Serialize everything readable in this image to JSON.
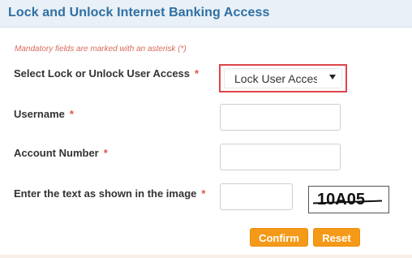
{
  "page": {
    "title": "Lock and Unlock Internet Banking Access",
    "mandatory_note": "Mandatory fields are marked with an asterisk (*)"
  },
  "form": {
    "asterisk": "*",
    "lock_unlock_label": "Select Lock or Unlock User Access",
    "lock_unlock_selected": "Lock User Access",
    "username_label": "Username",
    "username_value": "",
    "account_number_label": "Account Number",
    "account_number_value": "",
    "captcha_label": "Enter the text as shown in the image",
    "captcha_value": "",
    "captcha_text": "10A05"
  },
  "actions": {
    "confirm_label": "Confirm",
    "reset_label": "Reset"
  },
  "colors": {
    "title": "#2f6fa3",
    "header_bg": "#e9f0f7",
    "required": "#e25248",
    "note": "#d66a5c",
    "button": "#f59a18",
    "selected_outline": "#e0444b"
  },
  "icons": {
    "select_arrow": "chevron-down-icon"
  }
}
